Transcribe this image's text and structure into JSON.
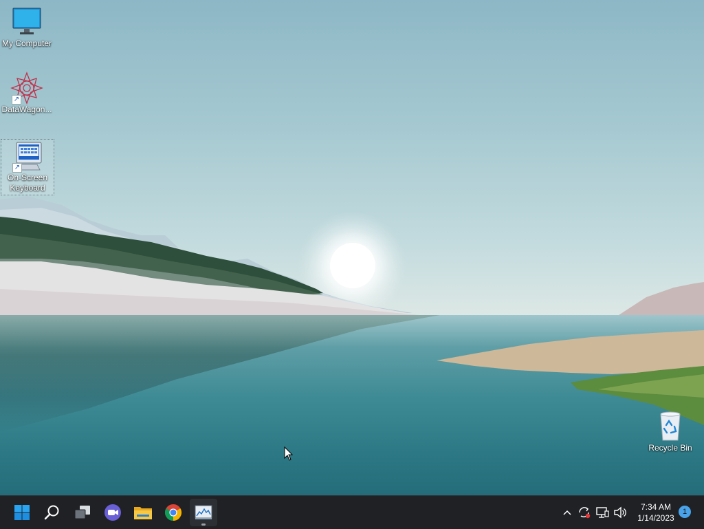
{
  "desktop": {
    "icons": [
      {
        "label": "My Computer",
        "icon": "monitor-icon"
      },
      {
        "label": "DataWagon...",
        "icon": "datawagon-icon"
      },
      {
        "label": "On-Screen Keyboard",
        "icon": "keyboard-icon"
      },
      {
        "label": "Recycle Bin",
        "icon": "recycle-bin-icon"
      }
    ]
  },
  "taskbar": {
    "apps": [
      {
        "icon": "windows-start-icon"
      },
      {
        "icon": "search-icon"
      },
      {
        "icon": "task-view-icon"
      },
      {
        "icon": "meet-video-icon"
      },
      {
        "icon": "file-explorer-icon"
      },
      {
        "icon": "chrome-icon"
      },
      {
        "icon": "performance-monitor-icon"
      }
    ],
    "tray": {
      "icons": [
        "chevron-up-icon",
        "sync-icon",
        "network-icon",
        "volume-icon"
      ],
      "time": "7:34 AM",
      "date": "1/14/2023",
      "notification_count": "1"
    }
  },
  "colors": {
    "taskbar_bg": "#1f2125",
    "accent_blue": "#1a8fe0",
    "water": "#2d7985"
  }
}
